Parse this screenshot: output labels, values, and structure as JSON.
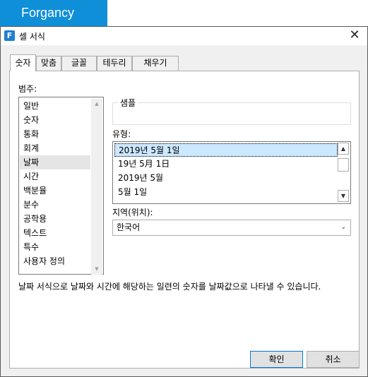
{
  "brand": {
    "label": "Forgancy"
  },
  "window": {
    "title": "셀 서식",
    "icon_letter": "F"
  },
  "tabs": [
    {
      "label": "숫자",
      "active": true
    },
    {
      "label": "맞춤",
      "active": false
    },
    {
      "label": "글꼴",
      "active": false
    },
    {
      "label": "테두리",
      "active": false
    },
    {
      "label": "채우기",
      "active": false
    }
  ],
  "category": {
    "label": "범주:",
    "items": [
      "일반",
      "숫자",
      "통화",
      "회계",
      "날짜",
      "시간",
      "백분율",
      "분수",
      "공학용",
      "텍스트",
      "특수",
      "사용자 정의"
    ],
    "selected": "날짜"
  },
  "sample": {
    "label": "샘플"
  },
  "type": {
    "label": "유형:",
    "items": [
      "2019년 5월 1일",
      "19년 5月 1日",
      "2019년 5월",
      "5월 1일"
    ],
    "selected": "2019년 5월 1일"
  },
  "locale": {
    "label": "지역(위치):",
    "value": "한국어"
  },
  "description": "날짜 서식으로 날짜와 시간에 해당하는 일련의 숫자를 날짜값으로 나타낼 수 있습니다.",
  "buttons": {
    "ok": "확인",
    "cancel": "취소"
  },
  "colors": {
    "brand": "#0f8fd8",
    "selection": "#cce8ff"
  }
}
